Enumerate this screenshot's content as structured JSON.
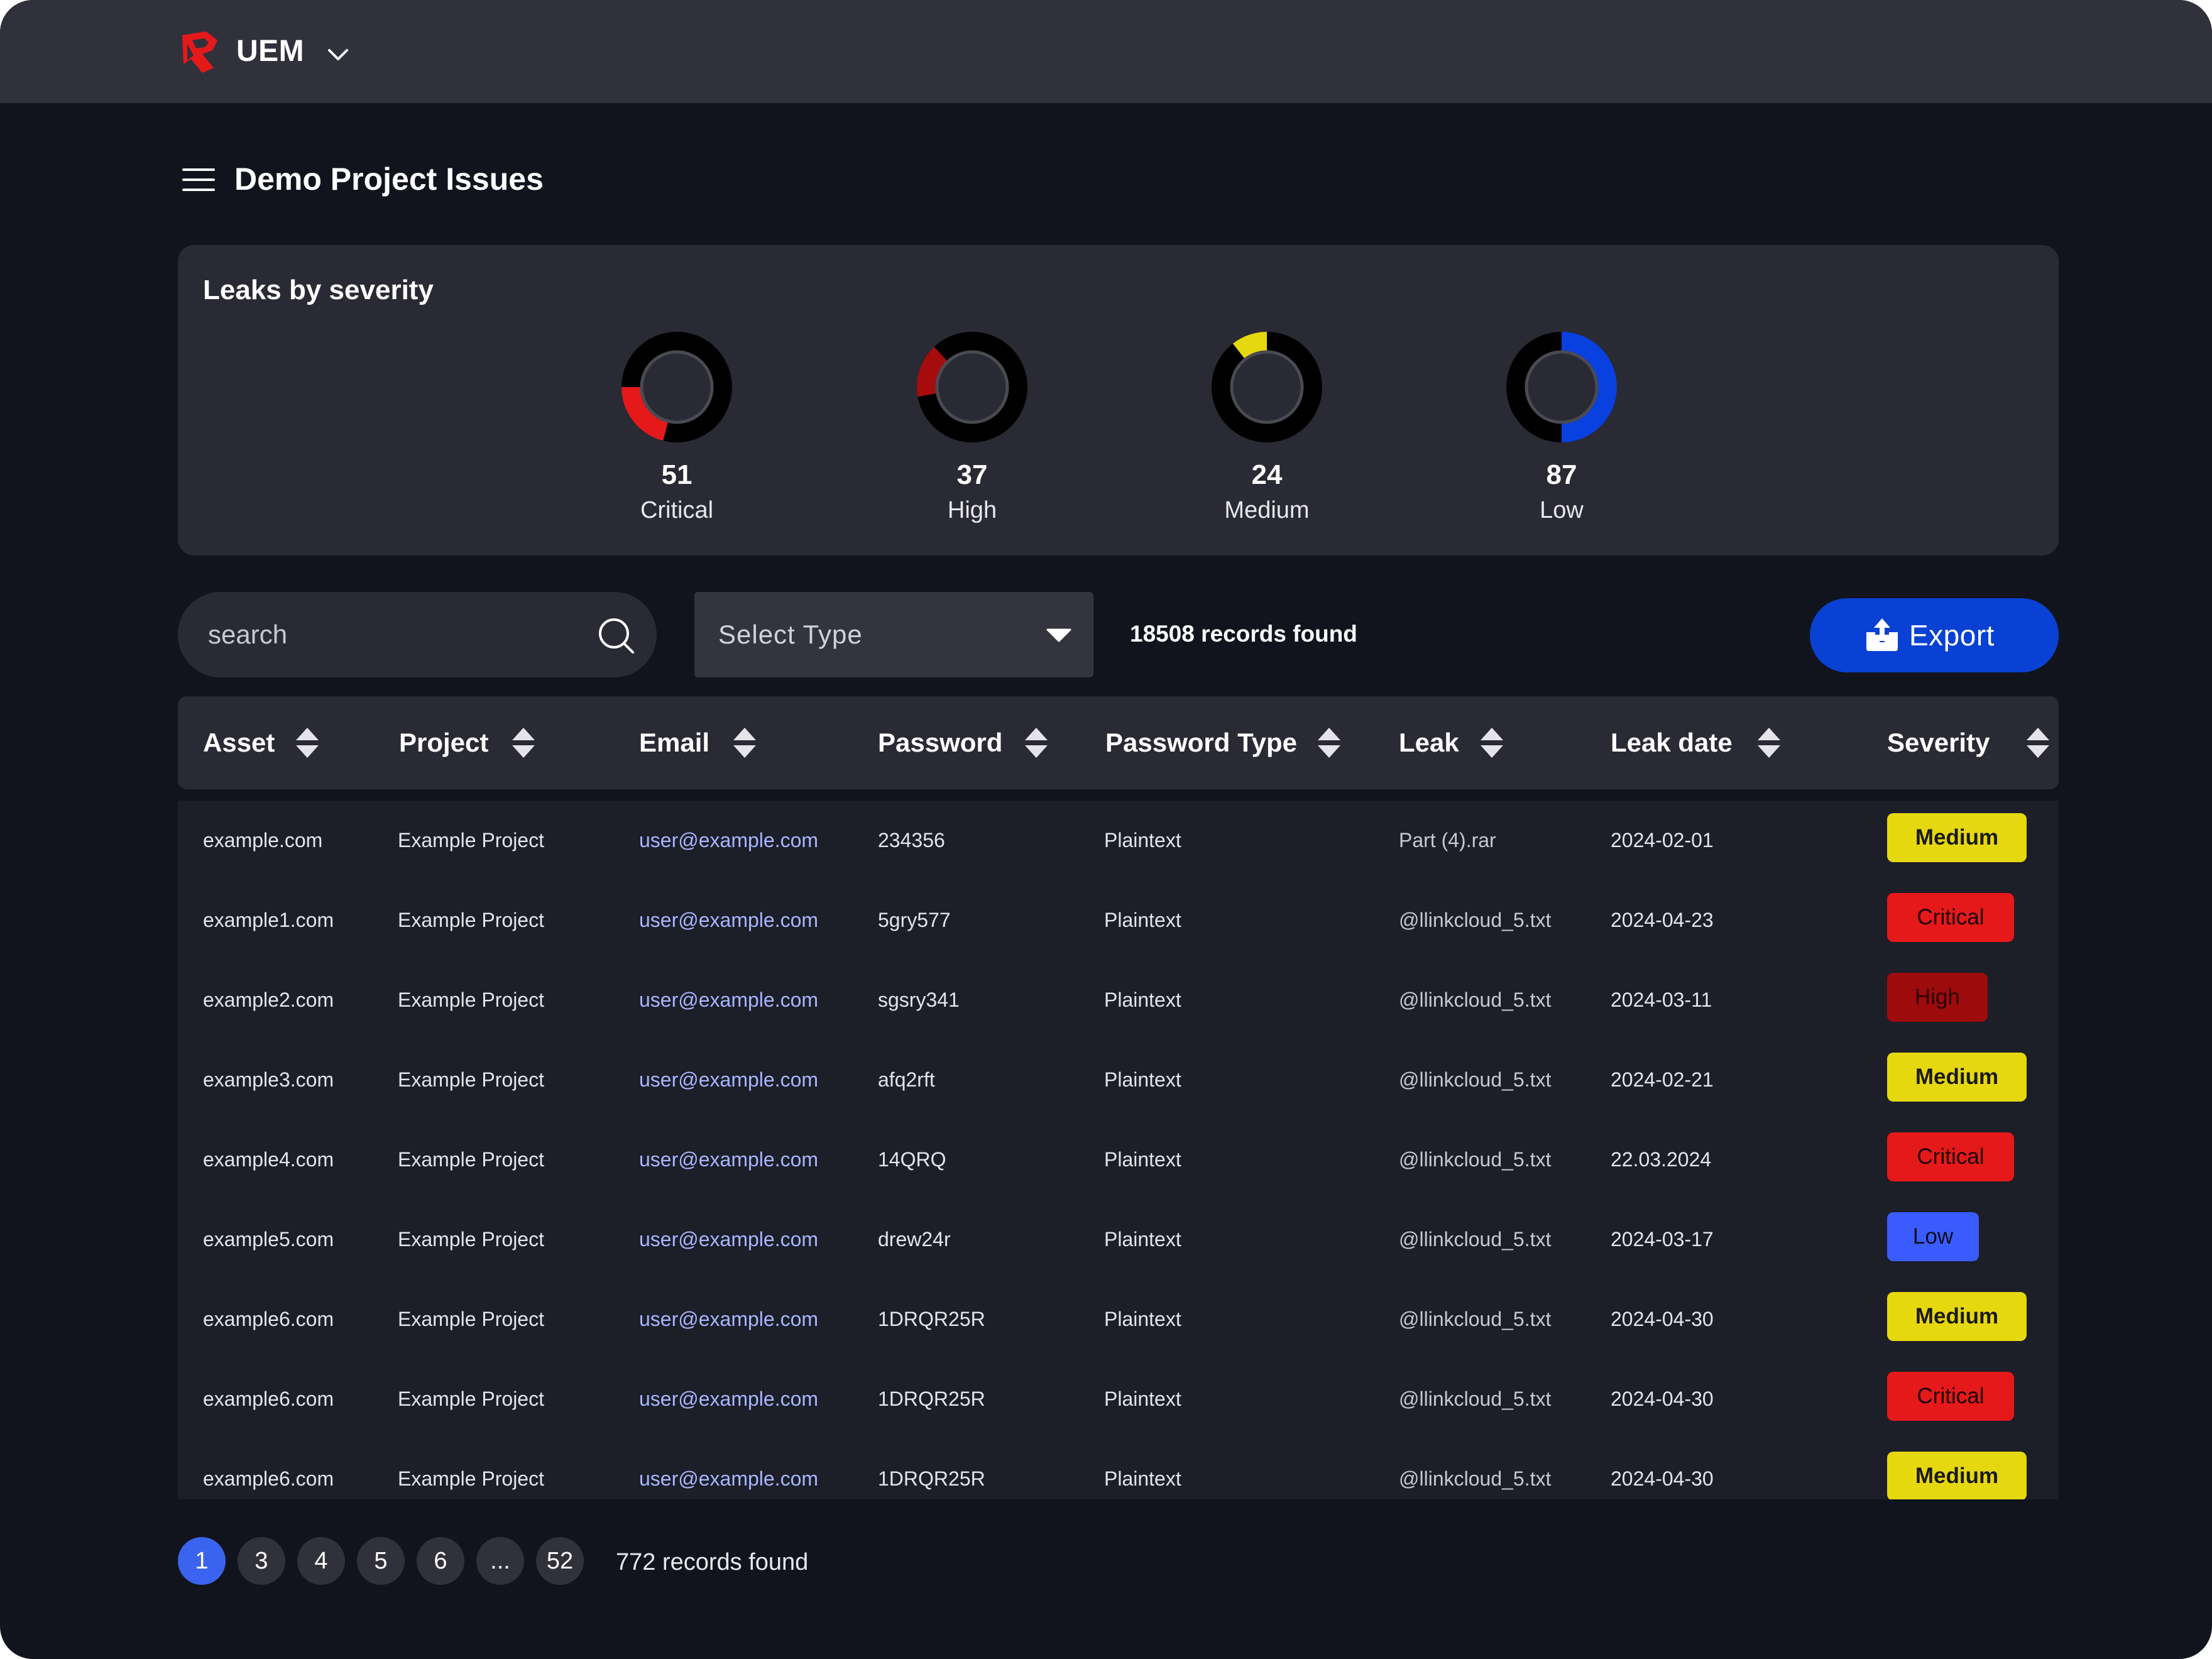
{
  "header": {
    "app_name": "UEM"
  },
  "page": {
    "title": "Demo Project Issues"
  },
  "severity_card": {
    "title": "Leaks by severity",
    "items": [
      {
        "count": "51",
        "label": "Critical",
        "color": "#e5191a"
      },
      {
        "count": "37",
        "label": "High",
        "color": "#a60c0d"
      },
      {
        "count": "24",
        "label": "Medium",
        "color": "#e6d80e"
      },
      {
        "count": "87",
        "label": "Low",
        "color": "#0841e0"
      }
    ]
  },
  "toolbar": {
    "search_placeholder": "search",
    "select_type": "Select Type",
    "records_found": "18508 records found",
    "export_label": "Export"
  },
  "table": {
    "columns": [
      "Asset",
      "Project",
      "Email",
      "Password",
      "Password Type",
      "Leak",
      "Leak date",
      "Severity"
    ],
    "rows": [
      {
        "asset": "example.com",
        "project": "Example Project",
        "email": "user@example.com",
        "password": "234356",
        "password_type": "Plaintext",
        "leak": "Part (4).rar",
        "date": "2024-02-01",
        "severity": "Medium"
      },
      {
        "asset": "example1.com",
        "project": "Example Project",
        "email": "user@example.com",
        "password": "5gry577",
        "password_type": "Plaintext",
        "leak": "@llinkcloud_5.txt",
        "date": "2024-04-23",
        "severity": "Critical"
      },
      {
        "asset": "example2.com",
        "project": "Example Project",
        "email": "user@example.com",
        "password": "sgsry341",
        "password_type": "Plaintext",
        "leak": "@llinkcloud_5.txt",
        "date": "2024-03-11",
        "severity": "High"
      },
      {
        "asset": "example3.com",
        "project": "Example Project",
        "email": "user@example.com",
        "password": "afq2rft",
        "password_type": "Plaintext",
        "leak": "@llinkcloud_5.txt",
        "date": "2024-02-21",
        "severity": "Medium"
      },
      {
        "asset": "example4.com",
        "project": "Example Project",
        "email": "user@example.com",
        "password": "14QRQ",
        "password_type": "Plaintext",
        "leak": "@llinkcloud_5.txt",
        "date": "22.03.2024",
        "severity": "Critical"
      },
      {
        "asset": "example5.com",
        "project": "Example Project",
        "email": "user@example.com",
        "password": "drew24r",
        "password_type": "Plaintext",
        "leak": "@llinkcloud_5.txt",
        "date": "2024-03-17",
        "severity": "Low"
      },
      {
        "asset": "example6.com",
        "project": "Example Project",
        "email": "user@example.com",
        "password": "1DRQR25R",
        "password_type": "Plaintext",
        "leak": "@llinkcloud_5.txt",
        "date": "2024-04-30",
        "severity": "Medium"
      },
      {
        "asset": "example6.com",
        "project": "Example Project",
        "email": "user@example.com",
        "password": "1DRQR25R",
        "password_type": "Plaintext",
        "leak": "@llinkcloud_5.txt",
        "date": "2024-04-30",
        "severity": "Critical"
      },
      {
        "asset": "example6.com",
        "project": "Example Project",
        "email": "user@example.com",
        "password": "1DRQR25R",
        "password_type": "Plaintext",
        "leak": "@llinkcloud_5.txt",
        "date": "2024-04-30",
        "severity": "Medium"
      }
    ]
  },
  "pagination": {
    "pages": [
      "1",
      "3",
      "4",
      "5",
      "6",
      "...",
      "52"
    ],
    "active": "1",
    "records_found": "772 records found"
  },
  "icons": {
    "logo": "shield-logo-icon",
    "app_menu": "chevron-down-icon",
    "menu": "hamburger-menu-icon",
    "search": "search-icon",
    "select": "caret-down-icon",
    "export": "upload-icon",
    "sort": "sort-icon"
  },
  "colors": {
    "accent": "#0841d3",
    "pagination_active": "#3a64f0",
    "email_link": "#a9b6ff",
    "background": "#12141d",
    "panel": "#2a2a34"
  }
}
